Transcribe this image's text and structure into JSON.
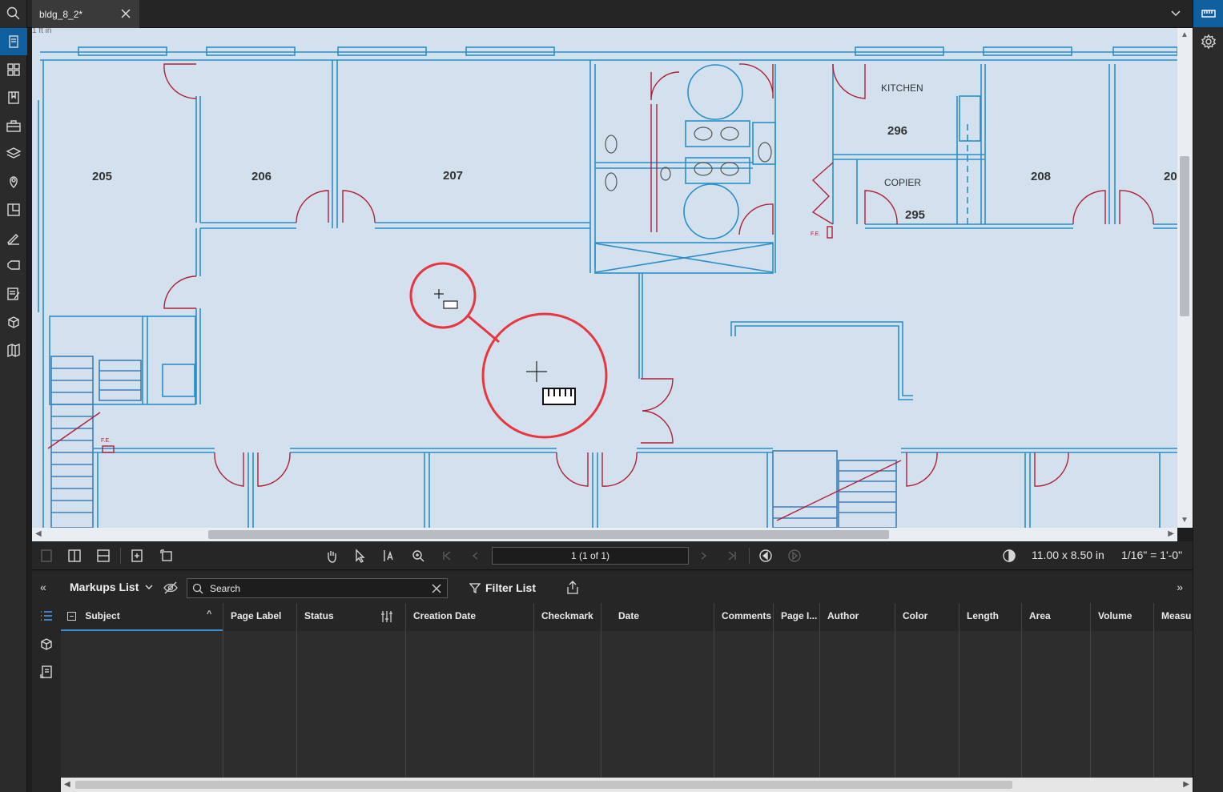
{
  "tabs": [
    {
      "label": "bldg_8_2*"
    }
  ],
  "canvas": {
    "scale_text": "1 ft in",
    "rooms": [
      {
        "id": "205",
        "label": "205"
      },
      {
        "id": "206",
        "label": "206"
      },
      {
        "id": "207",
        "label": "207"
      },
      {
        "id": "296",
        "label": "296"
      },
      {
        "id": "kitchen",
        "label": "KITCHEN"
      },
      {
        "id": "copier",
        "label": "COPIER"
      },
      {
        "id": "295",
        "label": "295"
      },
      {
        "id": "208",
        "label": "208"
      },
      {
        "id": "20x",
        "label": "20"
      }
    ],
    "fe_labels": [
      "F.E.",
      "F.E."
    ]
  },
  "toolbar": {
    "page_value": "1 (1 of 1)",
    "page_size": "11.00 x 8.50 in",
    "scale": "1/16\" = 1'-0\""
  },
  "markups": {
    "title": "Markups List",
    "search_placeholder": "Search",
    "filter_label": "Filter List",
    "columns": [
      {
        "label": "Subject"
      },
      {
        "label": "Page Label"
      },
      {
        "label": "Status"
      },
      {
        "label": "Creation Date"
      },
      {
        "label": "Checkmark"
      },
      {
        "label": "Date"
      },
      {
        "label": "Comments"
      },
      {
        "label": "Page I..."
      },
      {
        "label": "Author"
      },
      {
        "label": "Color"
      },
      {
        "label": "Length"
      },
      {
        "label": "Area"
      },
      {
        "label": "Volume"
      },
      {
        "label": "Measu"
      }
    ],
    "rows": []
  },
  "icons": {
    "left_rail": [
      "search-icon",
      "pages-icon",
      "thumbnails-icon",
      "bookmarks-icon",
      "toolchest-icon",
      "layers-icon",
      "places-icon",
      "spaces-icon",
      "signatures-icon",
      "tags-icon",
      "forms-icon",
      "3d-icon",
      "map-icon"
    ],
    "right_rail": [
      "measure-icon",
      "settings-icon"
    ]
  },
  "colors": {
    "accent": "#0f5f9e",
    "canvas_bg": "#d3e1ee",
    "wall_blue": "#2a8fc7",
    "door_red": "#b0213a",
    "loupe_red": "#e8363f"
  }
}
